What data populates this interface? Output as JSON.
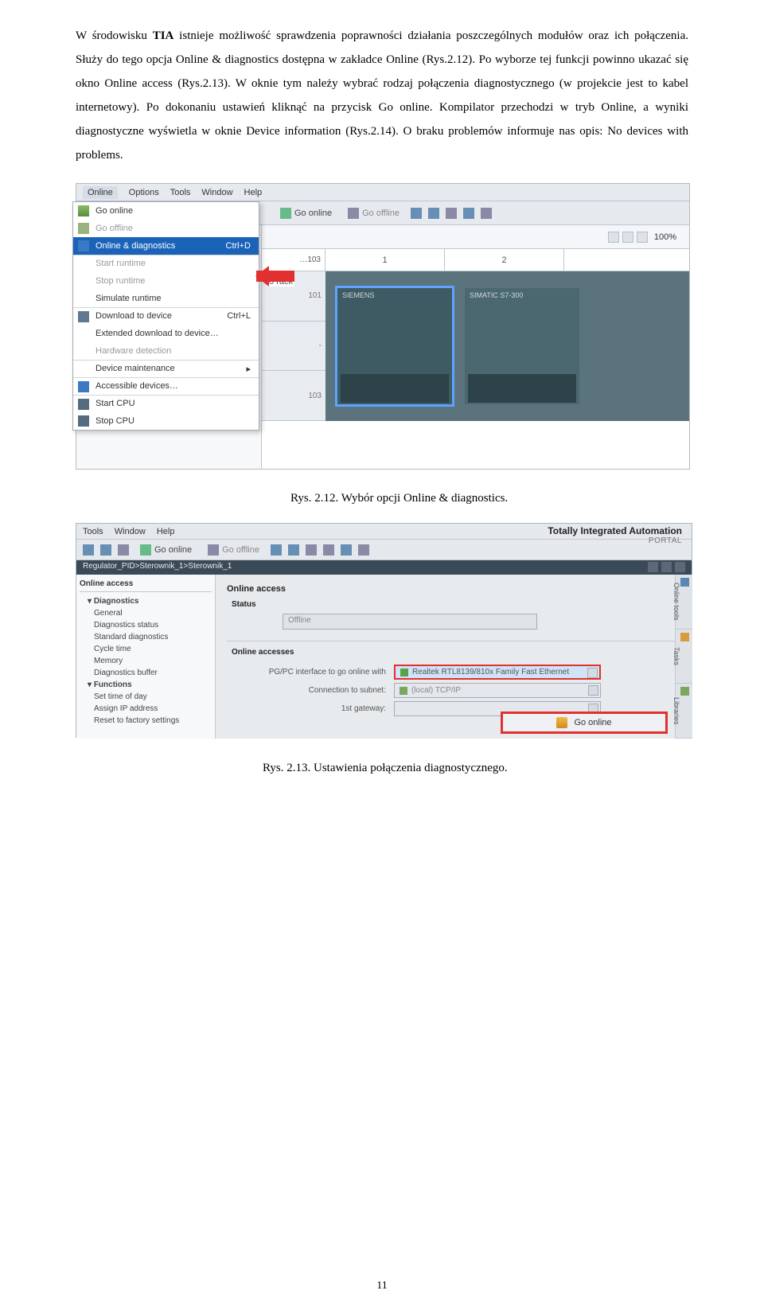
{
  "paragraph": {
    "t1a": "W  środowisku  ",
    "t1b": "TIA",
    "t1c": "  istnieje  możliwość  sprawdzenia  poprawności  działania poszczególnych  modułów  oraz  ich  połączenia.  Służy  do  tego  opcja  Online  & diagnostics  dostępna  w  zakładce  Online  (Rys.2.12).  Po  wyborze  tej  funkcji  powinno ukazać  się  okno  Online  access  (Rys.2.13).  W  oknie  tym  należy  wybrać  rodzaj połączenia  diagnostycznego  (w  projekcie  jest  to  kabel  internetowy).  Po  dokonaniu ustawień  kliknąć  na  przycisk  Go  online.  Kompilator  przechodzi  w  tryb  Online,  a wyniki  diagnostyczne  wyświetla  w  oknie  Device  information  (Rys.2.14).  O  braku problemów informuje nas opis: No devices with problems."
  },
  "shot1": {
    "menu": {
      "online": "Online",
      "options": "Options",
      "tools": "Tools",
      "window": "Window",
      "help": "Help"
    },
    "toolbar": {
      "goOnline": "Go online",
      "goOffline": "Go offline"
    },
    "plc": "1",
    "dropdown": {
      "goOnline": "Go online",
      "goOffline": "Go offline",
      "onlineDiag": "Online & diagnostics",
      "onlineDiagShortcut": "Ctrl+D",
      "startRT": "Start runtime",
      "stopRT": "Stop runtime",
      "simRT": "Simulate runtime",
      "download": "Download to device",
      "downloadShortcut": "Ctrl+L",
      "extDownload": "Extended download to device…",
      "hwDetect": "Hardware detection",
      "devMaint": "Device maintenance",
      "accDev": "Accessible devices…",
      "startCPU": "Start CPU",
      "stopCPU": "Stop CPU"
    },
    "editor": {
      "zoom": "100%",
      "grid103": "…103",
      "rack0": "0 rack",
      "col1": "1",
      "col2": "2",
      "row101": "101",
      "row103": "103",
      "siemens": "SIEMENS",
      "modLabel": "SIMATIC S7-300"
    }
  },
  "cap1": "Rys. 2.12. Wybór opcji Online & diagnostics.",
  "shot2": {
    "menu": {
      "tools": "Tools",
      "window": "Window",
      "help": "Help"
    },
    "tb": {
      "goOnline": "Go online",
      "goOffline": "Go offline"
    },
    "hdr": "Totally Integrated Automation",
    "portal": "PORTAL",
    "breadcrumb": "Regulator_PID>Sterownik_1>Sterownik_1",
    "tree": {
      "top": "Online access",
      "diag": "Diagnostics",
      "general": "General",
      "diagStatus": "Diagnostics status",
      "stdDiag": "Standard diagnostics",
      "cycle": "Cycle time",
      "memory": "Memory",
      "diagBuf": "Diagnostics buffer",
      "func": "Functions",
      "tod": "Set time of day",
      "ip": "Assign IP address",
      "reset": "Reset to factory settings"
    },
    "panel": {
      "title": "Online access",
      "statusLab": "Status",
      "statusVal": "Offline",
      "accTitle": "Online accesses",
      "pgpcLab": "PG/PC interface to go online with",
      "pgpcVal": "Realtek RTL8139/810x Family Fast Ethernet",
      "subnetLab": "Connection to subnet:",
      "subnetVal": "(local) TCP/IP",
      "gwLab": "1st gateway:",
      "goOnline": "Go online"
    },
    "tabs": {
      "t1": "Online tools",
      "t2": "Tasks",
      "t3": "Libraries"
    }
  },
  "cap2": "Rys. 2.13. Ustawienia połączenia diagnostycznego.",
  "pageno": "11"
}
